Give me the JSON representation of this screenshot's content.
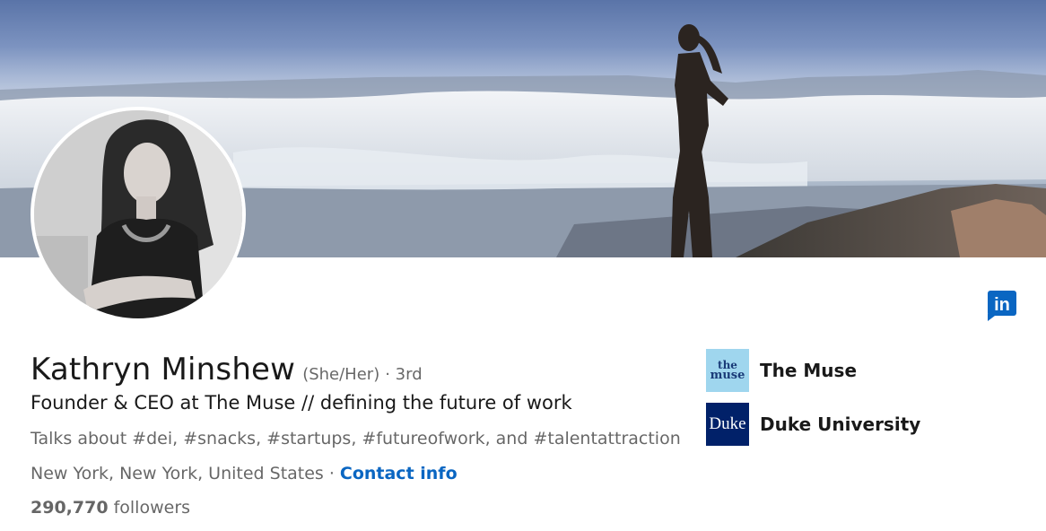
{
  "profile": {
    "name": "Kathryn Minshew",
    "pronouns": "(She/Her)",
    "connection_degree": "· 3rd",
    "headline": "Founder & CEO at The Muse // defining the future of work",
    "talks_about": "Talks about #dei, #snacks, #startups, #futureofwork, and #talentattraction",
    "location": "New York, New York, United States",
    "separator": "·",
    "contact_info_label": "Contact info",
    "followers_count": "290,770",
    "followers_label": "followers"
  },
  "organizations": [
    {
      "name": "The Muse",
      "logo_icon": "the-muse-logo",
      "logo_text_line1": "the",
      "logo_text_line2": "muse"
    },
    {
      "name": "Duke University",
      "logo_icon": "duke-logo",
      "logo_text": "Duke"
    }
  ],
  "brand": {
    "icon": "linkedin-icon",
    "icon_text": "in",
    "color": "#0a66c2"
  },
  "colors": {
    "link": "#0a66c2",
    "duke_blue": "#012169",
    "muse_blue": "#9fd6ee"
  }
}
